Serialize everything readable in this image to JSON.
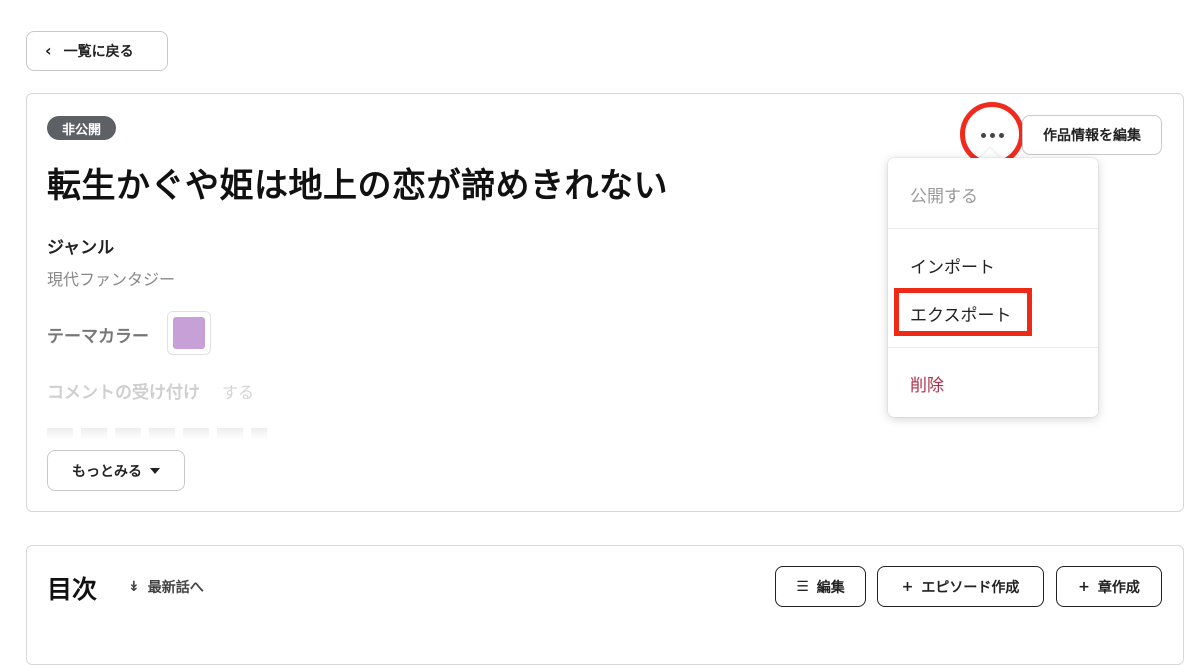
{
  "nav": {
    "back_label": "一覧に戻る"
  },
  "work": {
    "status_badge": "非公開",
    "title": "転生かぐや姫は地上の恋が諦めきれない",
    "genre_label": "ジャンル",
    "genre_value": "現代ファンタジー",
    "theme_color_label": "テーマカラー",
    "theme_color": "#c8a0d8",
    "comment_label": "コメントの受け付け",
    "comment_value": "する",
    "more_label": "もっとみる",
    "edit_info_label": "作品情報を編集"
  },
  "menu": {
    "publish": "公開する",
    "import": "インポート",
    "export": "エクスポート",
    "delete": "削除"
  },
  "toc": {
    "title": "目次",
    "latest_label": "最新話へ",
    "edit_label": "編集",
    "new_episode_label": "エピソード作成",
    "new_chapter_label": "章作成"
  },
  "colors": {
    "highlight_red": "#f02b1d",
    "delete_text": "#b0304a",
    "badge_bg": "#5d6166"
  }
}
